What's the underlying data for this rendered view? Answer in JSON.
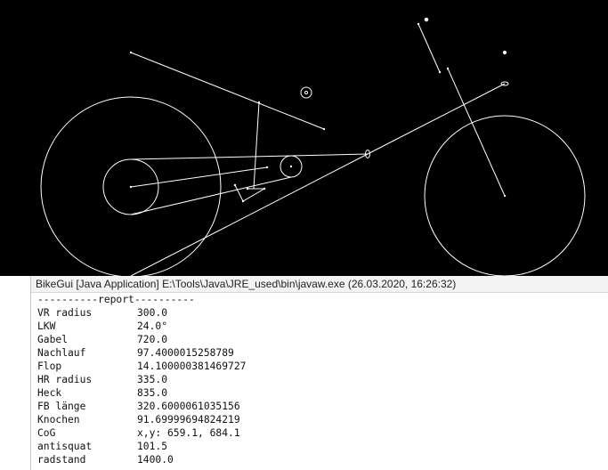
{
  "colors": {
    "canvas_bg": "#000000",
    "stroke": "#ffffff",
    "console_bg": "#ffffff",
    "console_text": "#111111"
  },
  "console": {
    "title": "BikeGui [Java Application] E:\\Tools\\Java\\JRE_used\\bin\\javaw.exe (26.03.2020, 16:26:32)",
    "report_header": "----------report----------",
    "rows": [
      {
        "key": "VR radius",
        "value": "300.0"
      },
      {
        "key": "LKW",
        "value": "24.0°"
      },
      {
        "key": "Gabel",
        "value": "720.0"
      },
      {
        "key": "Nachlauf",
        "value": "97.4000015258789"
      },
      {
        "key": "Flop",
        "value": "14.100000381469727"
      },
      {
        "key": "HR radius",
        "value": "335.0"
      },
      {
        "key": "Heck",
        "value": "835.0"
      },
      {
        "key": "FB länge",
        "value": "320.6000061035156"
      },
      {
        "key": "Knochen",
        "value": "91.69999694824219"
      },
      {
        "key": "CoG",
        "value": "x,y: 659.1, 684.1"
      },
      {
        "key": "antisquat",
        "value": "101.5"
      },
      {
        "key": "radstand",
        "value": "1400.0"
      }
    ]
  }
}
